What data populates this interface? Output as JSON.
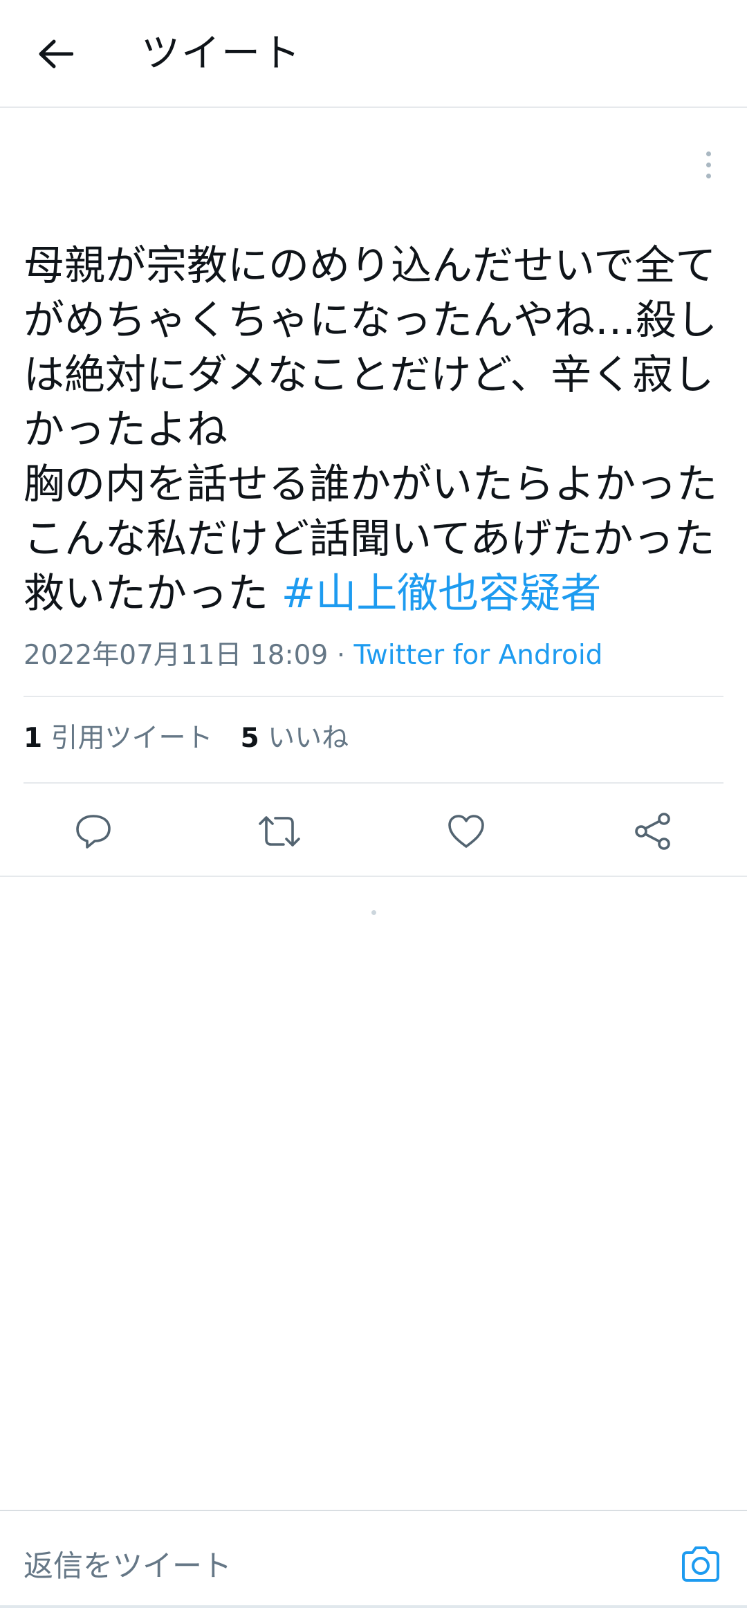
{
  "header": {
    "back_icon": "arrow-left-icon",
    "title": "ツイート"
  },
  "tweet": {
    "more_icon": "more-vertical-icon",
    "text": "母親が宗教にのめり込んだせいで全てがめちゃくちゃになったんやね…殺しは絶対にダメなことだけど、辛く寂しかったよね\n胸の内を話せる誰かがいたらよかった\nこんな私だけど話聞いてあげたかった\n救いたかった ",
    "hashtag": "#山上徹也容疑者",
    "timestamp": "2022年07月11日 18:09",
    "separator": " · ",
    "source": "Twitter for Android"
  },
  "stats": {
    "quote_count": "1",
    "quote_label": "引用ツイート",
    "like_count": "5",
    "like_label": "いいね"
  },
  "actions": {
    "reply_icon": "reply-icon",
    "retweet_icon": "retweet-icon",
    "like_icon": "heart-icon",
    "share_icon": "share-icon"
  },
  "reply_bar": {
    "placeholder": "返信をツイート",
    "camera_icon": "camera-icon"
  },
  "colors": {
    "accent": "#1d9bf0",
    "text": "#0f1419",
    "secondary": "#657786",
    "divider": "#e6e9ec"
  }
}
